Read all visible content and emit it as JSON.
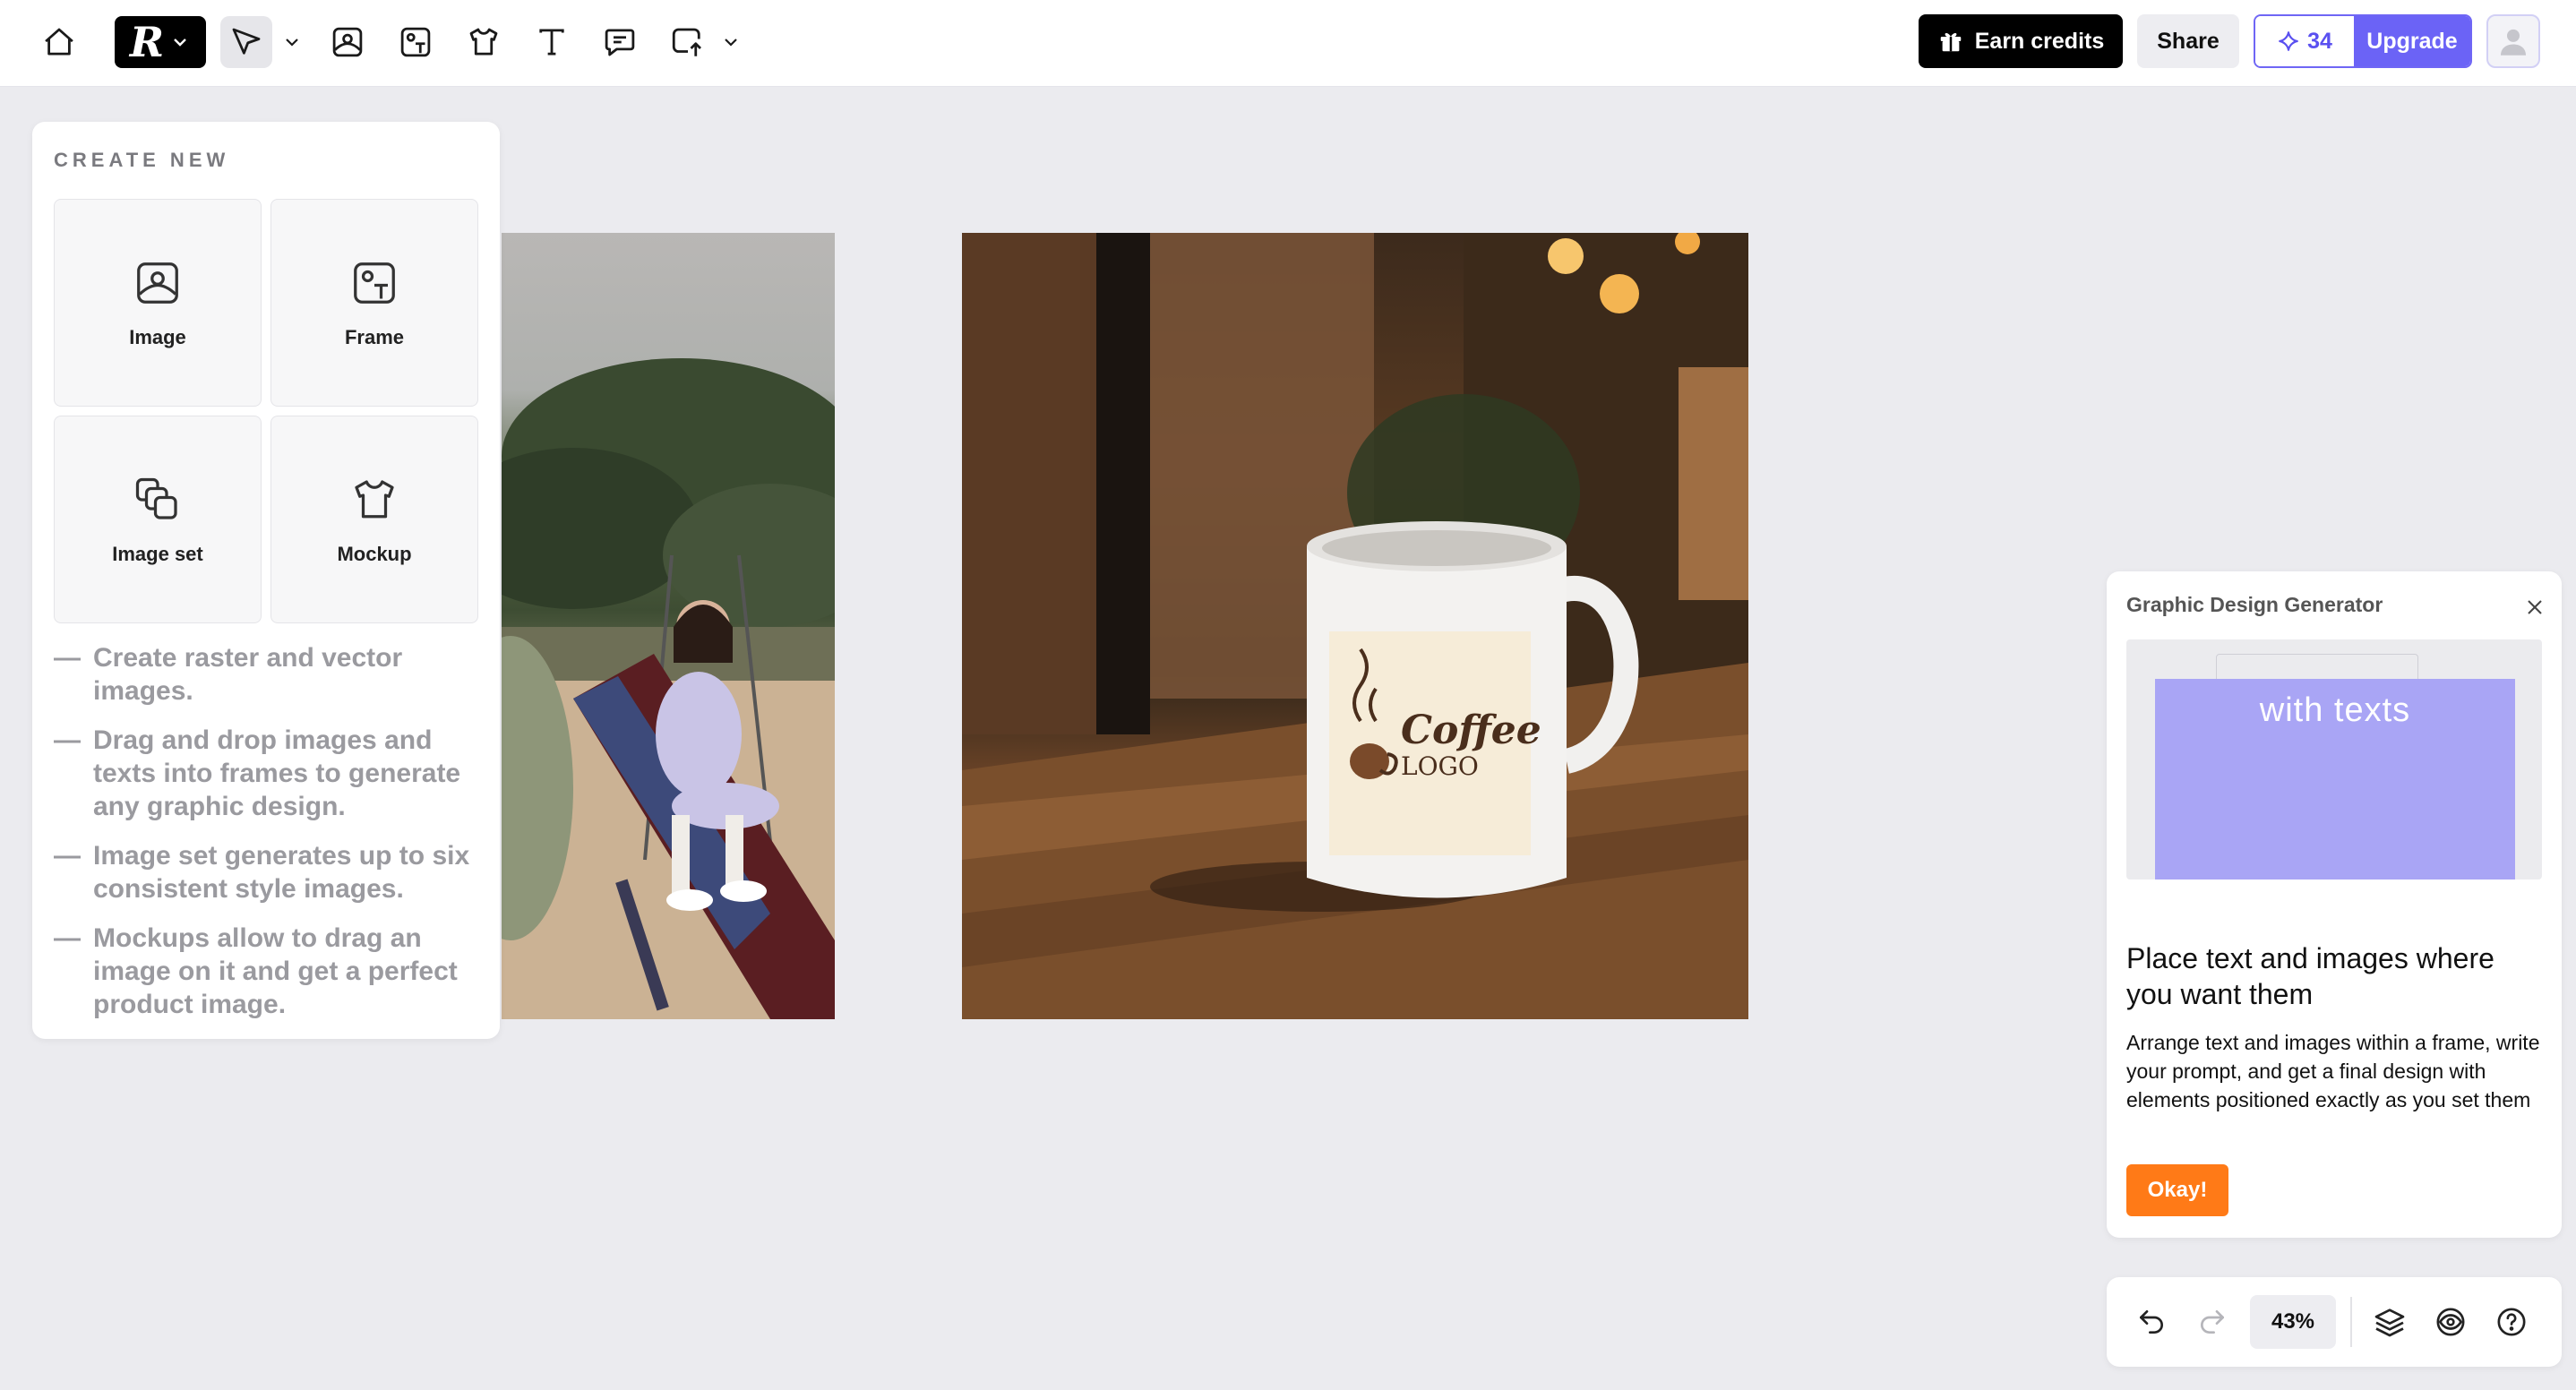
{
  "toolbar": {
    "icons": [
      "home-icon",
      "brand-logo",
      "select-cursor-icon",
      "image-icon",
      "frame-icon",
      "mockup-icon",
      "text-icon",
      "comment-icon",
      "upload-icon"
    ],
    "logo_text": "R",
    "earn_credits_label": "Earn credits",
    "share_label": "Share",
    "credits_count": "34",
    "upgrade_label": "Upgrade"
  },
  "create_panel": {
    "title": "CREATE NEW",
    "cards": [
      {
        "label": "Image",
        "icon": "image-icon"
      },
      {
        "label": "Frame",
        "icon": "frame-icon"
      },
      {
        "label": "Image set",
        "icon": "image-set-icon"
      },
      {
        "label": "Mockup",
        "icon": "mockup-icon"
      }
    ],
    "notes": [
      "Create raster and vector images.",
      "Drag and drop images and texts into frames to generate any graphic design.",
      "Image set generates up to six consistent style images.",
      "Mockups allow to drag an image on it and get a perfect product image."
    ],
    "note_dash": "—"
  },
  "canvas": {
    "mug_logo_line1": "Coffee",
    "mug_logo_line2": "LOGO"
  },
  "info_card": {
    "title": "Graphic Design Generator",
    "preview_text": "with texts",
    "heading": "Place text and images where you want them",
    "body": "Arrange text and images within a frame, write your prompt, and get a final design with elements positioned exactly as you set them",
    "okay_label": "Okay!"
  },
  "bottom_bar": {
    "zoom": "43%",
    "icons": [
      "undo-icon",
      "redo-icon",
      "layers-icon",
      "visibility-icon",
      "help-icon"
    ]
  },
  "colors": {
    "accent": "#6b63f6",
    "okay": "#ff7a17",
    "canvas_bg": "#ebebef"
  }
}
